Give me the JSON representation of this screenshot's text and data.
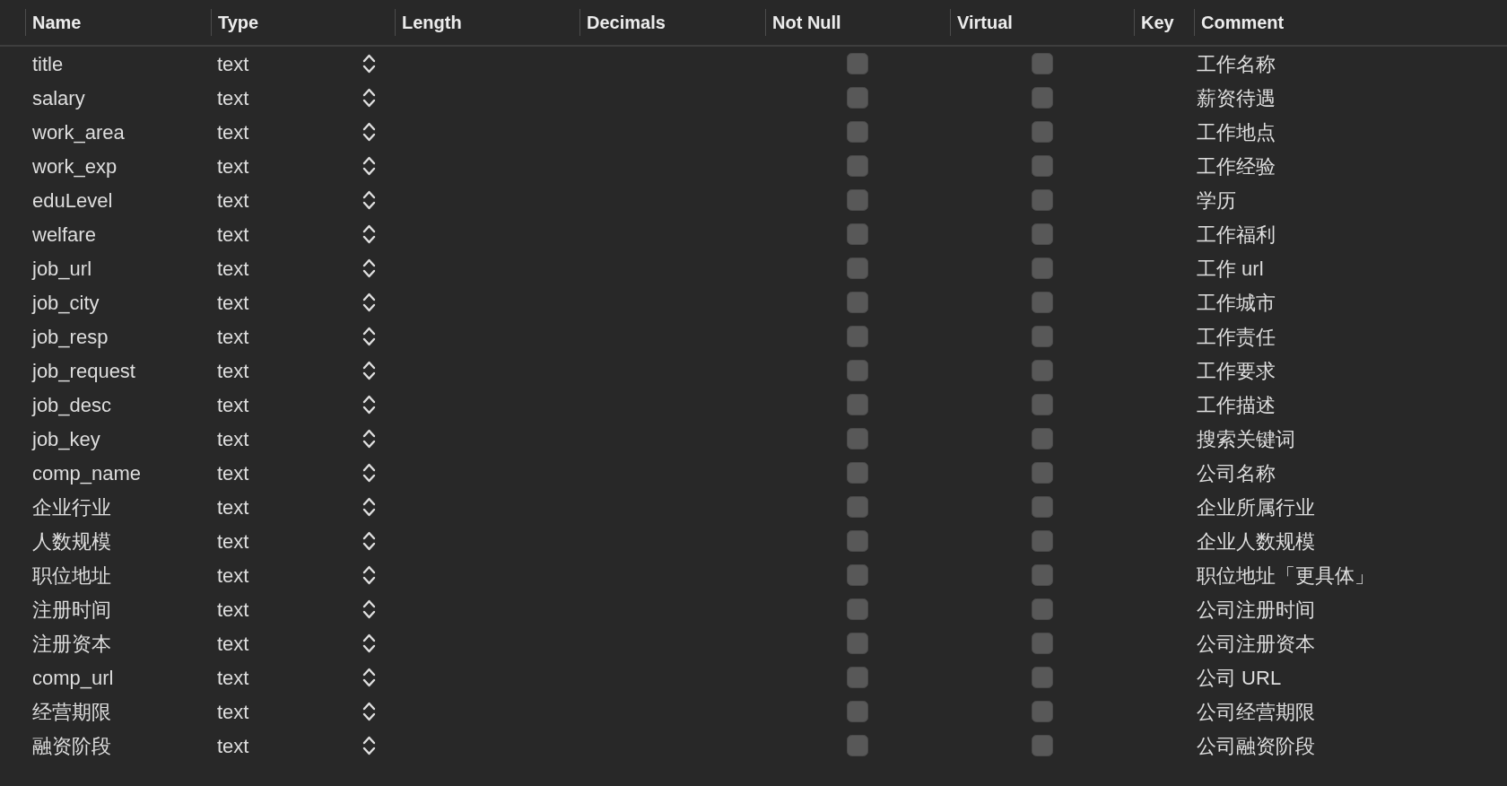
{
  "table": {
    "columns": [
      "Name",
      "Type",
      "Length",
      "Decimals",
      "Not Null",
      "Virtual",
      "Key",
      "Comment"
    ],
    "rows": [
      {
        "name": "title",
        "type": "text",
        "not_null": false,
        "virtual": false,
        "comment": "工作名称"
      },
      {
        "name": "salary",
        "type": "text",
        "not_null": false,
        "virtual": false,
        "comment": "薪资待遇"
      },
      {
        "name": "work_area",
        "type": "text",
        "not_null": false,
        "virtual": false,
        "comment": "工作地点"
      },
      {
        "name": "work_exp",
        "type": "text",
        "not_null": false,
        "virtual": false,
        "comment": "工作经验"
      },
      {
        "name": "eduLevel",
        "type": "text",
        "not_null": false,
        "virtual": false,
        "comment": "学历"
      },
      {
        "name": "welfare",
        "type": "text",
        "not_null": false,
        "virtual": false,
        "comment": "工作福利"
      },
      {
        "name": "job_url",
        "type": "text",
        "not_null": false,
        "virtual": false,
        "comment": "工作 url"
      },
      {
        "name": "job_city",
        "type": "text",
        "not_null": false,
        "virtual": false,
        "comment": "工作城市"
      },
      {
        "name": "job_resp",
        "type": "text",
        "not_null": false,
        "virtual": false,
        "comment": "工作责任"
      },
      {
        "name": "job_request",
        "type": "text",
        "not_null": false,
        "virtual": false,
        "comment": "工作要求"
      },
      {
        "name": "job_desc",
        "type": "text",
        "not_null": false,
        "virtual": false,
        "comment": "工作描述"
      },
      {
        "name": "job_key",
        "type": "text",
        "not_null": false,
        "virtual": false,
        "comment": "搜索关键词"
      },
      {
        "name": "comp_name",
        "type": "text",
        "not_null": false,
        "virtual": false,
        "comment": "公司名称"
      },
      {
        "name": "企业行业",
        "type": "text",
        "not_null": false,
        "virtual": false,
        "comment": "企业所属行业"
      },
      {
        "name": "人数规模",
        "type": "text",
        "not_null": false,
        "virtual": false,
        "comment": "企业人数规模"
      },
      {
        "name": "职位地址",
        "type": "text",
        "not_null": false,
        "virtual": false,
        "comment": "职位地址「更具体」"
      },
      {
        "name": "注册时间",
        "type": "text",
        "not_null": false,
        "virtual": false,
        "comment": "公司注册时间"
      },
      {
        "name": "注册资本",
        "type": "text",
        "not_null": false,
        "virtual": false,
        "comment": "公司注册资本"
      },
      {
        "name": "comp_url",
        "type": "text",
        "not_null": false,
        "virtual": false,
        "comment": "公司 URL"
      },
      {
        "name": "经营期限",
        "type": "text",
        "not_null": false,
        "virtual": false,
        "comment": "公司经营期限"
      },
      {
        "name": "融资阶段",
        "type": "text",
        "not_null": false,
        "virtual": false,
        "comment": "公司融资阶段"
      }
    ]
  }
}
